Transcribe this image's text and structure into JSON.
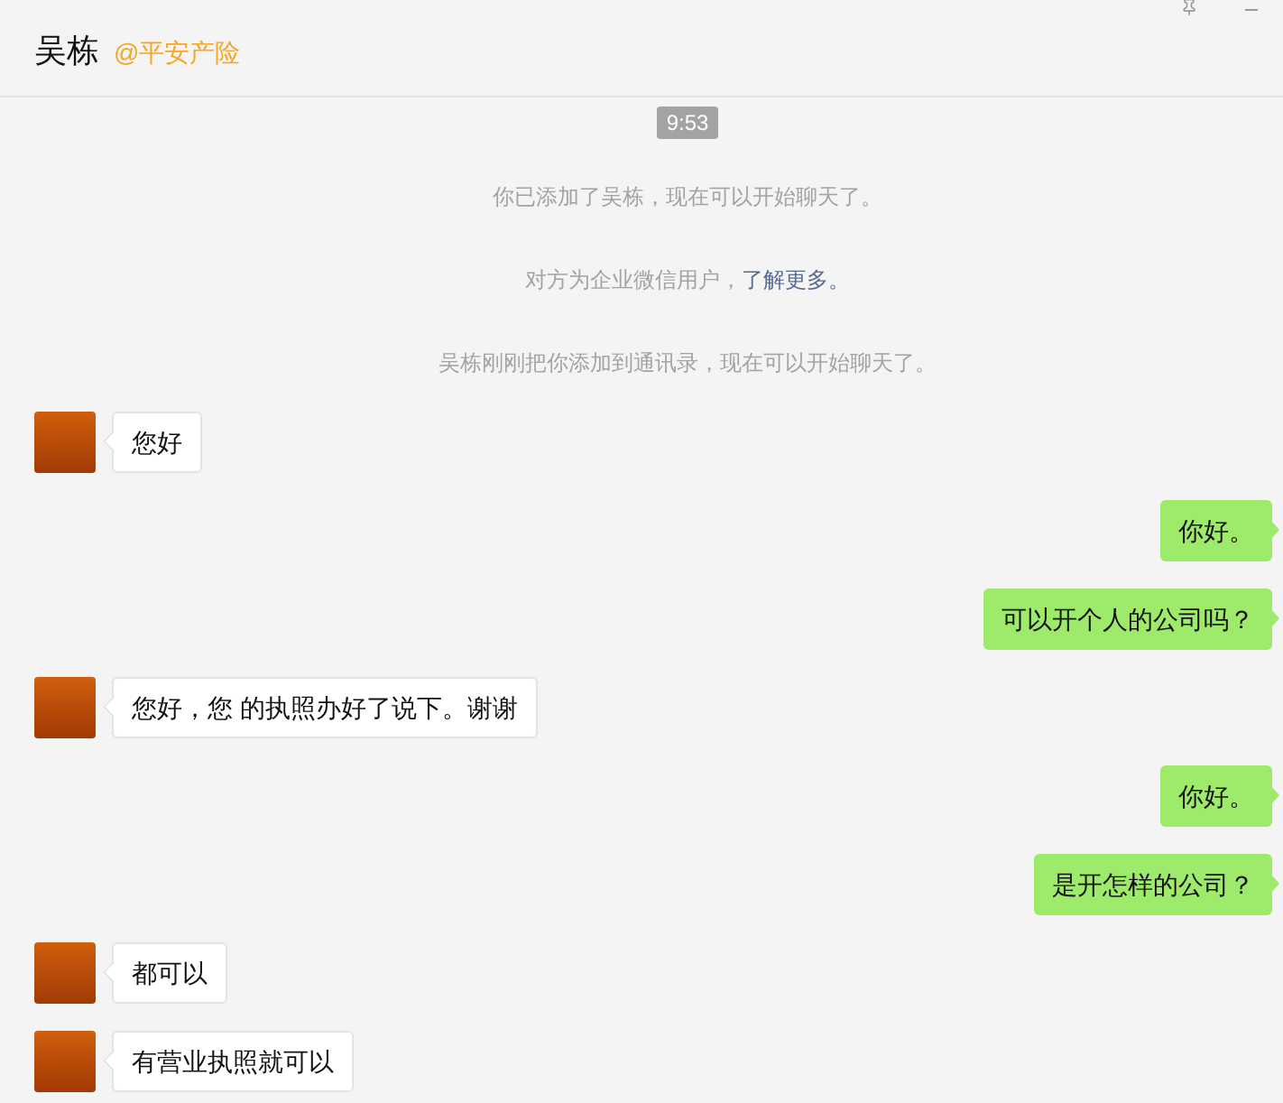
{
  "header": {
    "title": "吴栋",
    "organization": "@平安产险"
  },
  "timestamp": "9:53",
  "system_messages": [
    {
      "text": "你已添加了吴栋，现在可以开始聊天了。"
    },
    {
      "text": "对方为企业微信用户，",
      "link": "了解更多。"
    },
    {
      "text": "吴栋刚刚把你添加到通讯录，现在可以开始聊天了。"
    }
  ],
  "messages": [
    {
      "kind": "received",
      "text": "您好"
    },
    {
      "kind": "sent",
      "text": "你好。"
    },
    {
      "kind": "sent",
      "text": "可以开个人的公司吗？"
    },
    {
      "kind": "received",
      "text": "您好，您 的执照办好了说下。谢谢"
    },
    {
      "kind": "sent",
      "text": "你好。"
    },
    {
      "kind": "sent",
      "text": "是开怎样的公司？"
    },
    {
      "kind": "received",
      "text": "都可以"
    },
    {
      "kind": "received",
      "text": "有营业执照就可以"
    }
  ]
}
